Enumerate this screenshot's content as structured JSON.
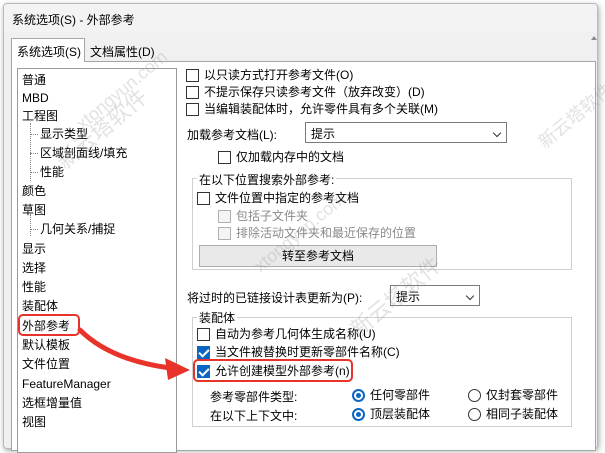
{
  "window": {
    "title": "系统选项(S) - 外部参考"
  },
  "tabs": [
    {
      "label": "系统选项(S)",
      "active": true
    },
    {
      "label": "文档属性(D)",
      "active": false
    }
  ],
  "nav": {
    "items": [
      {
        "label": "普通"
      },
      {
        "label": "MBD"
      },
      {
        "label": "工程图"
      },
      {
        "label": "显示类型"
      },
      {
        "label": "区域剖面线/填充"
      },
      {
        "label": "性能"
      },
      {
        "label": "颜色"
      },
      {
        "label": "草图"
      },
      {
        "label": "几何关系/捕捉"
      },
      {
        "label": "显示"
      },
      {
        "label": "选择"
      },
      {
        "label": "性能"
      },
      {
        "label": "装配体"
      },
      {
        "label": "外部参考",
        "selected": true
      },
      {
        "label": "默认模板"
      },
      {
        "label": "文件位置"
      },
      {
        "label": "FeatureManager"
      },
      {
        "label": "选框增量值"
      },
      {
        "label": "视图"
      }
    ]
  },
  "options": {
    "open_readonly": "以只读方式打开参考文件(O)",
    "no_prompt_save": "不提示保存只读参考文件（放弃改变）(D)",
    "multi_context": "当编辑装配体时，允许零件具有多个关联(M)",
    "load_refs_label": "加载参考文档(L):",
    "load_refs_value": "提示",
    "load_in_memory_only": "仅加载内存中的文档",
    "search_group_title": "在以下位置搜索外部参考:",
    "file_locations_refs": "文件位置中指定的参考文档",
    "include_subfolders": "包括子文件夹",
    "exclude_active_folder": "排除活动文件夹和最近保存的位置",
    "goto_refs_button": "转至参考文档",
    "update_out_of_date_label": "将过时的已链接设计表更新为(P):",
    "update_out_of_date_value": "提示",
    "assembly_group_title": "装配体",
    "auto_name_ref_geometry": "自动为参考几何体生成名称(U)",
    "update_component_names": "当文件被替换时更新零部件名称(C)",
    "allow_external_refs": "允许创建模型外部参考(n)",
    "ref_component_type_label": "参考零部件类型:",
    "ref_type_any": "任何零部件",
    "ref_type_sealed": "仅封套零部件",
    "context_label": "在以下上下文中:",
    "context_top": "顶层装配体",
    "context_same": "相同子装配体"
  },
  "watermarks": [
    "新云塔软件",
    "xtongyun.com"
  ],
  "colors": {
    "accent": "#0a66c2",
    "highlight": "#e8332a"
  }
}
